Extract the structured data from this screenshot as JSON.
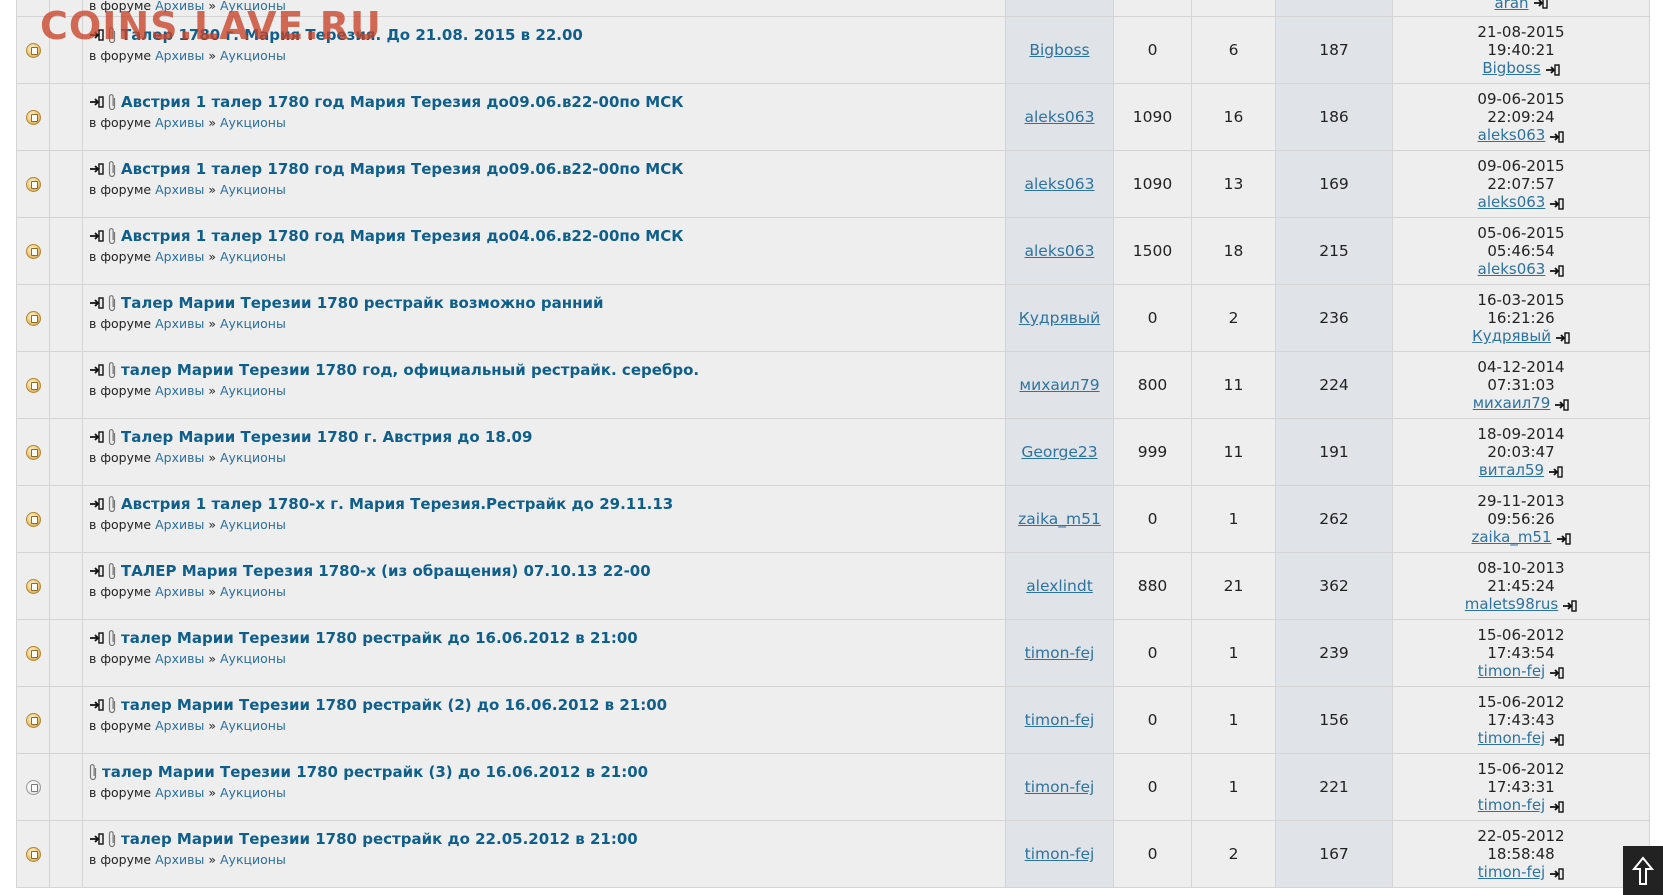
{
  "watermark": "COINS.LAVE.RU",
  "forum_prefix": "в форуме",
  "forum_sep": "»",
  "top_partial": {
    "forum": "Архивы",
    "subforum": "Аукционы",
    "last_user": "aran"
  },
  "rows": [
    {
      "title": "Талер 1780 г. Мария Терезия. До 21.08. 2015 в 22.00",
      "forum": "Архивы",
      "subforum": "Аукционы",
      "author": "Bigboss",
      "price": "0",
      "replies": "6",
      "views": "187",
      "date": "21-08-2015",
      "time": "19:40:21",
      "last_user": "Bigboss"
    },
    {
      "title": "Австрия 1 талер 1780 год Мария Терезия до09.06.в22-00по МСК",
      "forum": "Архивы",
      "subforum": "Аукционы",
      "author": "aleks063",
      "price": "1090",
      "replies": "16",
      "views": "186",
      "date": "09-06-2015",
      "time": "22:09:24",
      "last_user": "aleks063"
    },
    {
      "title": "Австрия 1 талер 1780 год Мария Терезия до09.06.в22-00по МСК",
      "forum": "Архивы",
      "subforum": "Аукционы",
      "author": "aleks063",
      "price": "1090",
      "replies": "13",
      "views": "169",
      "date": "09-06-2015",
      "time": "22:07:57",
      "last_user": "aleks063"
    },
    {
      "title": "Австрия 1 талер 1780 год Мария Терезия до04.06.в22-00по МСК",
      "forum": "Архивы",
      "subforum": "Аукционы",
      "author": "aleks063",
      "price": "1500",
      "replies": "18",
      "views": "215",
      "date": "05-06-2015",
      "time": "05:46:54",
      "last_user": "aleks063"
    },
    {
      "title": "Талер Марии Терезии 1780 рестрайк возможно ранний",
      "forum": "Архивы",
      "subforum": "Аукционы",
      "author": "Кудрявый",
      "price": "0",
      "replies": "2",
      "views": "236",
      "date": "16-03-2015",
      "time": "16:21:26",
      "last_user": "Кудрявый"
    },
    {
      "title": "талер Марии Терезии 1780 год, официальный рестрайк. серебро.",
      "forum": "Архивы",
      "subforum": "Аукционы",
      "author": "михаил79",
      "price": "800",
      "replies": "11",
      "views": "224",
      "date": "04-12-2014",
      "time": "07:31:03",
      "last_user": "михаил79"
    },
    {
      "title": "Талер Марии Терезии 1780 г. Австрия до 18.09",
      "forum": "Архивы",
      "subforum": "Аукционы",
      "author": "George23",
      "price": "999",
      "replies": "11",
      "views": "191",
      "date": "18-09-2014",
      "time": "20:03:47",
      "last_user": "витал59"
    },
    {
      "title": "Австрия 1 талер 1780-х г. Мария Терезия.Рестрайк до 29.11.13",
      "forum": "Архивы",
      "subforum": "Аукционы",
      "author": "zaika_m51",
      "price": "0",
      "replies": "1",
      "views": "262",
      "date": "29-11-2013",
      "time": "09:56:26",
      "last_user": "zaika_m51"
    },
    {
      "title": "ТАЛЕР Мария Терезия 1780-х (из обращения) 07.10.13 22-00",
      "forum": "Архивы",
      "subforum": "Аукционы",
      "author": "alexlindt",
      "price": "880",
      "replies": "21",
      "views": "362",
      "date": "08-10-2013",
      "time": "21:45:24",
      "last_user": "malets98rus"
    },
    {
      "title": "талер Марии Терезии 1780 рестрайк до 16.06.2012 в 21:00",
      "forum": "Архивы",
      "subforum": "Аукционы",
      "author": "timon-fej",
      "price": "0",
      "replies": "1",
      "views": "239",
      "date": "15-06-2012",
      "time": "17:43:54",
      "last_user": "timon-fej"
    },
    {
      "title": "талер Марии Терезии 1780 рестрайк (2) до 16.06.2012 в 21:00",
      "forum": "Архивы",
      "subforum": "Аукционы",
      "author": "timon-fej",
      "price": "0",
      "replies": "1",
      "views": "156",
      "date": "15-06-2012",
      "time": "17:43:43",
      "last_user": "timon-fej"
    },
    {
      "title": "талер Марии Терезии 1780 рестрайк (3) до 16.06.2012 в 21:00",
      "forum": "Архивы",
      "subforum": "Аукционы",
      "author": "timon-fej",
      "price": "0",
      "replies": "1",
      "views": "221",
      "date": "15-06-2012",
      "time": "17:43:31",
      "last_user": "timon-fej",
      "no_new_marker": true
    },
    {
      "title": "талер Марии Терезии 1780 рестрайк до 22.05.2012 в 21:00",
      "forum": "Архивы",
      "subforum": "Аукционы",
      "author": "timon-fej",
      "price": "0",
      "replies": "2",
      "views": "167",
      "date": "22-05-2012",
      "time": "18:58:48",
      "last_user": "timon-fej"
    }
  ],
  "scroll_top_icon": "arrow-up-icon"
}
